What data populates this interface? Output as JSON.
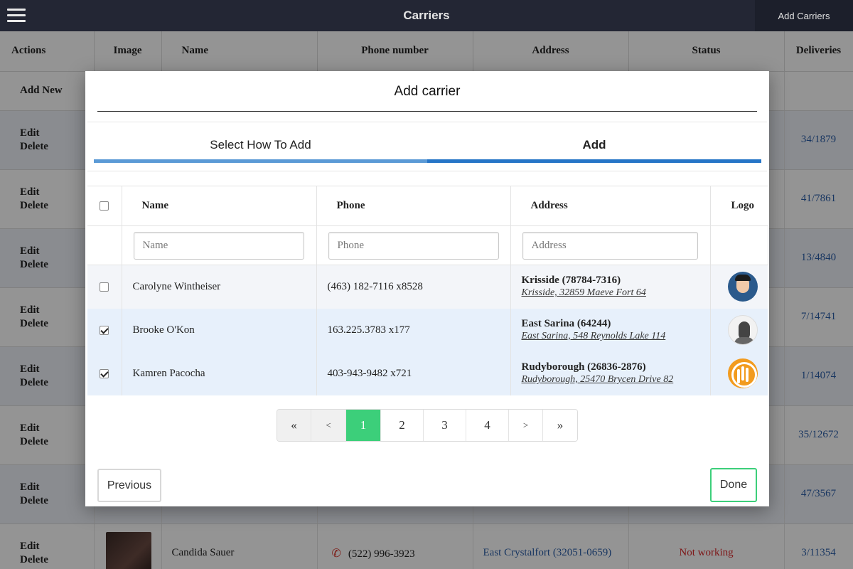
{
  "topbar": {
    "title": "Carriers",
    "add_button": "Add Carriers",
    "menu_icon": "hamburger-icon"
  },
  "background_table": {
    "headers": [
      "Actions",
      "Image",
      "Name",
      "Phone number",
      "Address",
      "Status",
      "Deliveries"
    ],
    "add_new_label": "Add New",
    "edit_label": "Edit",
    "delete_label": "Delete",
    "deliveries": [
      "34/1879",
      "41/7861",
      "13/4840",
      "7/14741",
      "1/14074",
      "35/12672",
      "47/3567",
      "3/11354"
    ],
    "last_row": {
      "name": "Candida Sauer",
      "phone": "(522) 996-3923",
      "address": "East Crystalfort (32051-0659)",
      "status": "Not working"
    },
    "status_color": "#d9282a",
    "link_color": "#2a5da8"
  },
  "modal": {
    "title": "Add carrier",
    "steps": [
      "Select How To Add",
      "Add"
    ],
    "active_step": 1,
    "table": {
      "headers": {
        "name": "Name",
        "phone": "Phone",
        "address": "Address",
        "logo": "Logo"
      },
      "filters": {
        "name_placeholder": "Name",
        "phone_placeholder": "Phone",
        "address_placeholder": "Address"
      },
      "rows": [
        {
          "checked": false,
          "name": "Carolyne Wintheiser",
          "phone": "(463) 182-7116 x8528",
          "address_title": "Krisside (78784-7316)",
          "address_sub": "Krisside, 32859 Maeve Fort 64",
          "logo": "avatar-bearded-man"
        },
        {
          "checked": true,
          "name": "Brooke O'Kon",
          "phone": "163.225.3783 x177",
          "address_title": "East Sarina (64244)",
          "address_sub": "East Sarina, 548 Reynolds Lake 114",
          "logo": "avatar-photo-man"
        },
        {
          "checked": true,
          "name": "Kamren Pacocha",
          "phone": "403-943-9482 x721",
          "address_title": "Rudyborough (26836-2876)",
          "address_sub": "Rudyborough, 25470 Brycen Drive 82",
          "logo": "avatar-cactus"
        }
      ]
    },
    "pagination": {
      "first": "«",
      "prev": "<",
      "pages": [
        "1",
        "2",
        "3",
        "4"
      ],
      "current": "1",
      "next": ">",
      "last": "»"
    },
    "buttons": {
      "previous": "Previous",
      "done": "Done"
    },
    "accent_color": "#3ccf7a",
    "step_color": "#2675c7"
  }
}
